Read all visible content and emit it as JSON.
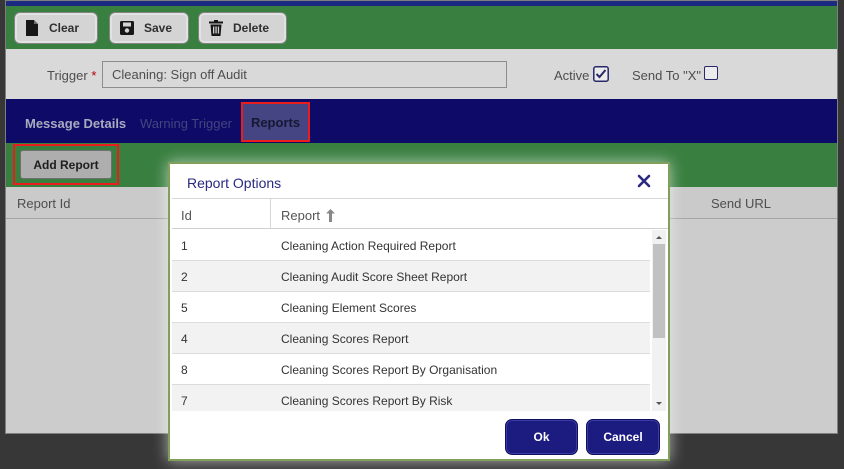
{
  "toolbar": {
    "clear_label": "Clear",
    "save_label": "Save",
    "delete_label": "Delete"
  },
  "form": {
    "trigger_label": "Trigger",
    "required_mark": "*",
    "trigger_value": "Cleaning: Sign off Audit",
    "active_label": "Active",
    "active_checked": true,
    "send_to_label": "Send To \"X\"",
    "send_to_checked": false
  },
  "tabs": [
    {
      "label": "Message Details"
    },
    {
      "label": "Warning Trigger"
    },
    {
      "label": "Reports",
      "selected": true
    }
  ],
  "subbar": {
    "add_report_label": "Add Report"
  },
  "grid": {
    "columns": [
      "Report Id",
      "Send URL"
    ]
  },
  "dialog": {
    "title": "Report Options",
    "columns": {
      "id": "Id",
      "report": "Report"
    },
    "sort": "ascending",
    "rows": [
      {
        "id": "1",
        "report": "Cleaning Action Required Report"
      },
      {
        "id": "2",
        "report": "Cleaning Audit Score Sheet Report"
      },
      {
        "id": "5",
        "report": "Cleaning Element Scores"
      },
      {
        "id": "4",
        "report": "Cleaning Scores Report"
      },
      {
        "id": "8",
        "report": "Cleaning Scores Report By Organisation"
      },
      {
        "id": "7",
        "report": "Cleaning Scores Report By Risk"
      }
    ],
    "ok_label": "Ok",
    "cancel_label": "Cancel"
  },
  "colors": {
    "toolbar_green": "#3e8a46",
    "tab_navy": "#0f0c70",
    "dialog_button": "#1c1c80",
    "highlight_red": "#ff1f1f"
  },
  "icons": [
    "file-icon",
    "save-icon",
    "trash-icon",
    "checkbox-checked-icon",
    "checkbox-empty-icon",
    "close-icon",
    "sort-up-icon",
    "scroll-up-icon",
    "scroll-down-icon"
  ]
}
